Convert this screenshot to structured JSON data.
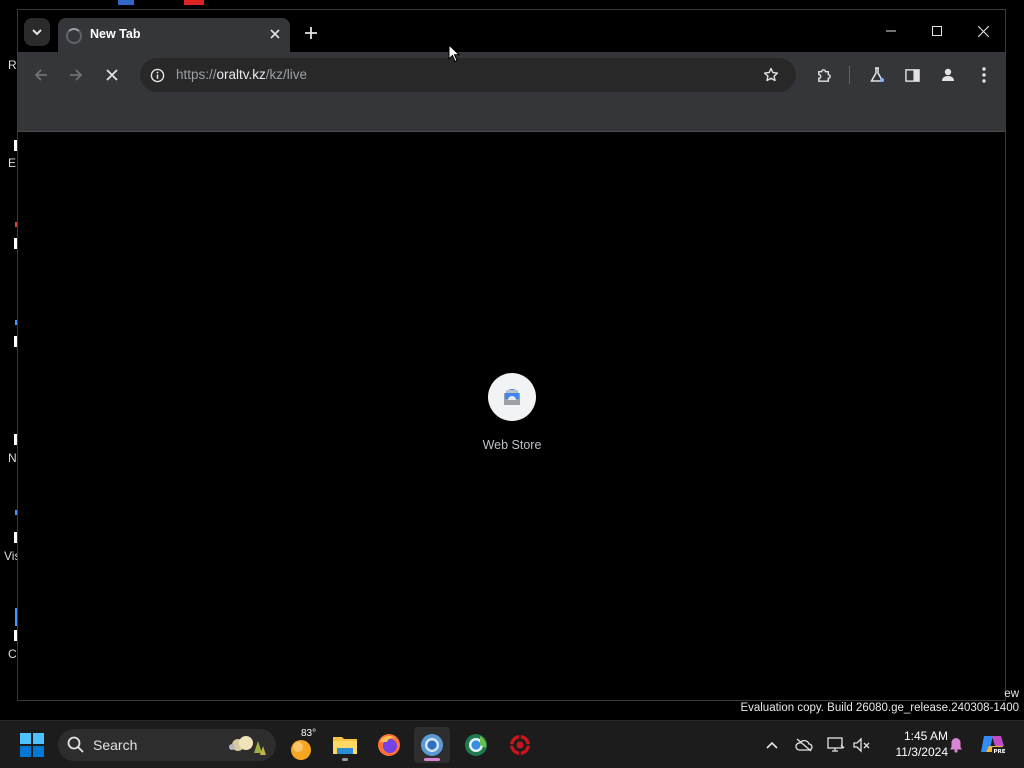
{
  "desktop": {
    "fragments": [
      "R",
      "E",
      "N",
      "Vis",
      "C"
    ]
  },
  "browser": {
    "tab": {
      "title": "New Tab",
      "loading": true
    },
    "address_bar": {
      "scheme": "https://",
      "host": "oraltv.kz",
      "path": "/kz/live"
    },
    "shortcuts": [
      {
        "label": "Web Store",
        "icon": "web-store-icon"
      }
    ]
  },
  "watermark": {
    "fragment": "ew",
    "text": "Evaluation copy. Build 26080.ge_release.240308-1400"
  },
  "taskbar": {
    "search_label": "Search",
    "weather_temp": "83°",
    "apps": [
      "file-explorer-icon",
      "firefox-icon",
      "chrome-icon",
      "edge-beta-icon",
      "security-app-icon"
    ],
    "clock": {
      "time": "1:45 AM",
      "date": "11/3/2024"
    },
    "accent_color": "#0078d4"
  }
}
